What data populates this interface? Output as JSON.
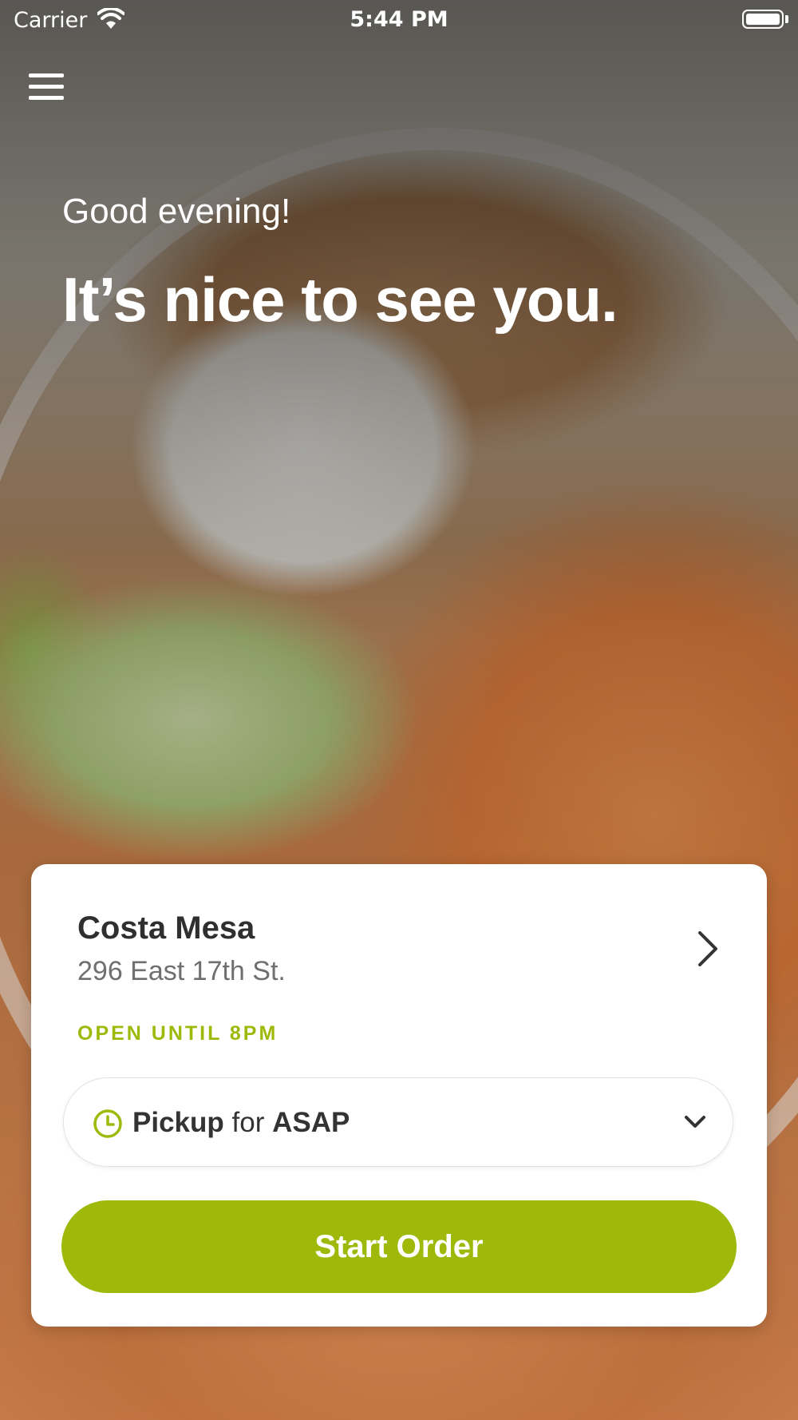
{
  "status_bar": {
    "carrier": "Carrier",
    "time": "5:44 PM"
  },
  "hero": {
    "greeting": "Good evening!",
    "tagline": "It’s nice to see you."
  },
  "location_card": {
    "store_name": "Costa Mesa",
    "address": "296 East 17th St.",
    "hours": "OPEN UNTIL 8PM",
    "order_mode": {
      "mode": "Pickup",
      "connector": "for",
      "time": "ASAP"
    },
    "start_button": "Start Order"
  },
  "colors": {
    "accent": "#9fb90a",
    "text_dark": "#2f2f2f",
    "text_muted": "#6f6f6f"
  },
  "icons": [
    "wifi-icon",
    "battery-icon",
    "hamburger-menu-icon",
    "chevron-right-icon",
    "clock-icon",
    "chevron-down-icon"
  ]
}
